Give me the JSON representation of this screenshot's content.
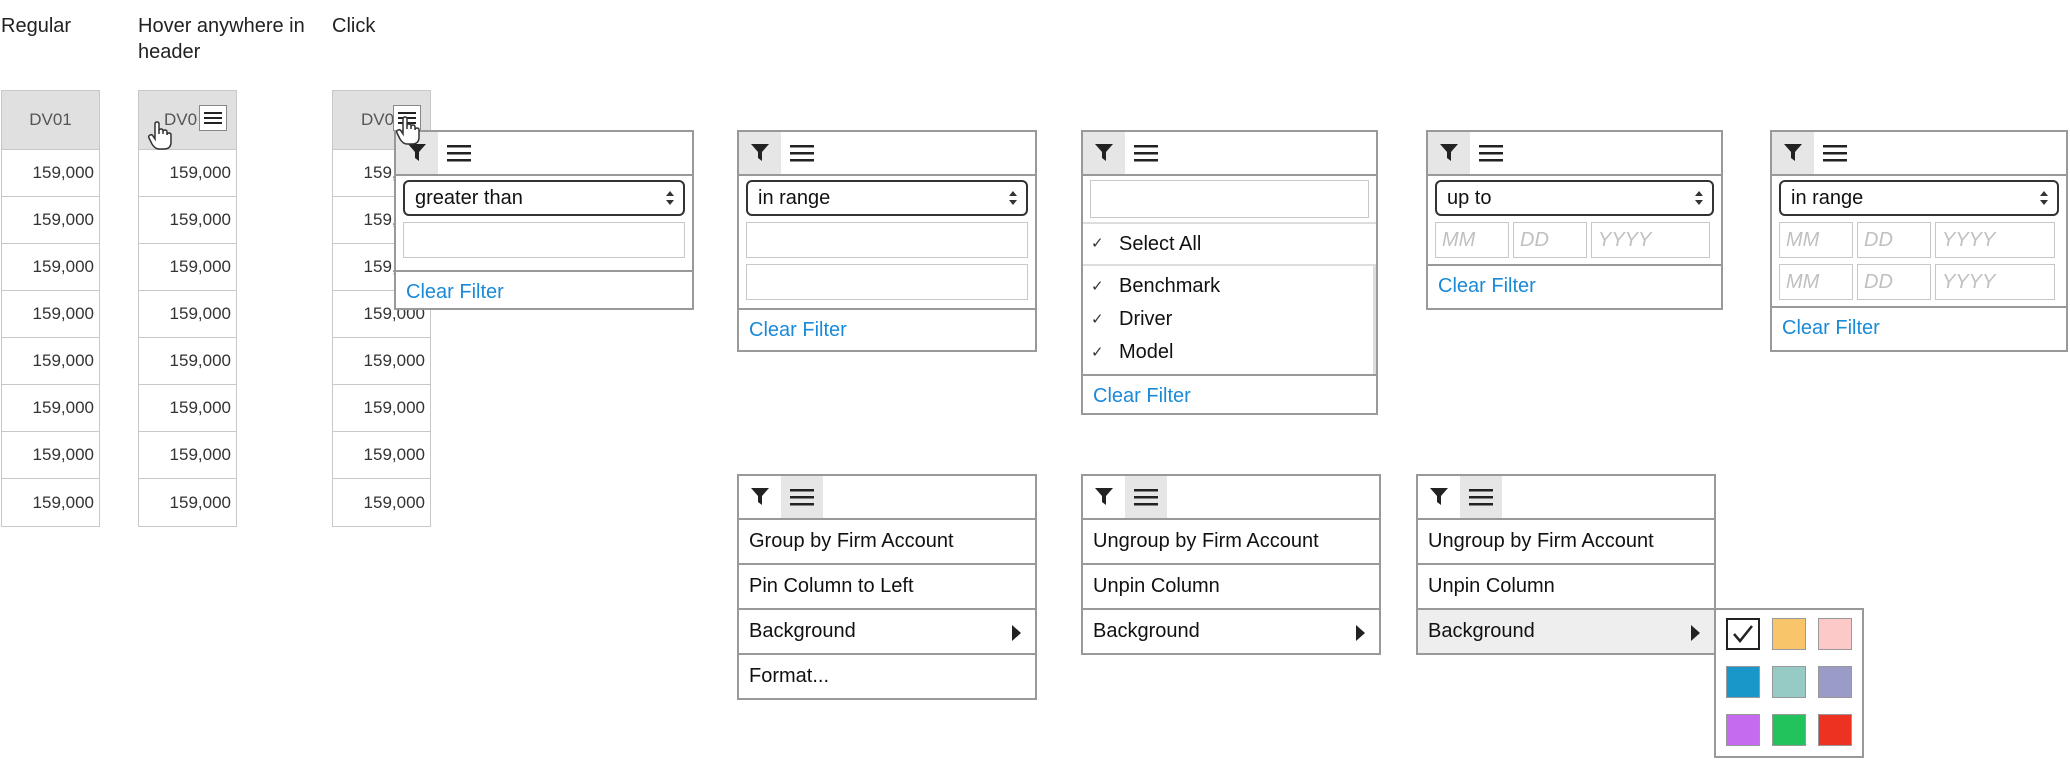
{
  "states": {
    "regular": "Regular",
    "hover": "Hover anywhere in header",
    "click": "Click"
  },
  "grid": {
    "header": "DV01",
    "header_truncated": "DV0",
    "values": [
      "159,000",
      "159,000",
      "159,000",
      "159,000",
      "159,000",
      "159,000",
      "159,000",
      "159,000"
    ]
  },
  "filter_number": {
    "operator": "greater than",
    "clear": "Clear Filter"
  },
  "filter_range": {
    "operator": "in range",
    "clear": "Clear Filter"
  },
  "filter_set": {
    "select_all": "Select All",
    "items": [
      "Benchmark",
      "Driver",
      "Model"
    ],
    "clear": "Clear Filter"
  },
  "filter_date": {
    "operator": "up to",
    "mm": "MM",
    "dd": "DD",
    "yyyy": "YYYY",
    "clear": "Clear Filter"
  },
  "filter_date_range": {
    "operator": "in range",
    "mm": "MM",
    "dd": "DD",
    "yyyy": "YYYY",
    "clear": "Clear Filter"
  },
  "menu1": {
    "items": [
      "Group by Firm Account",
      "Pin Column to Left",
      "Background",
      "Format..."
    ]
  },
  "menu2": {
    "items": [
      "Ungroup by Firm Account",
      "Unpin Column",
      "Background"
    ]
  },
  "menu3": {
    "items": [
      "Ungroup by Firm Account",
      "Unpin Column",
      "Background"
    ]
  },
  "swatches": {
    "colors": [
      "#ffffff",
      "#f9c56a",
      "#fcc8c8",
      "#1a97c9",
      "#96cbc5",
      "#9b9bc8",
      "#c56bf0",
      "#22c25d",
      "#ee3222"
    ],
    "selected": 0
  },
  "icons": {
    "filter": "filter-icon",
    "menu": "hamburger-menu-icon",
    "hand": "pointer-hand-icon",
    "check": "checkmark-icon",
    "submenu": "submenu-arrow-icon"
  }
}
